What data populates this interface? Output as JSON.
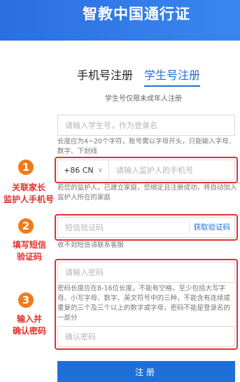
{
  "header": {
    "title": "智教中国通行证"
  },
  "tabs": [
    {
      "label": "手机号注册",
      "active": false
    },
    {
      "label": "学生号注册",
      "active": true
    }
  ],
  "subtitle": "学生号仅限未成年人注册",
  "student_id": {
    "placeholder": "请输入学生号，作为登录名",
    "hint": "长度应为4~20个字符，账号需以字母开头，只能输入字母、数字、下划线"
  },
  "guardian_phone": {
    "country_code": "+86 CN",
    "placeholder": "请输入监护人的手机号",
    "hint": "若您的监护人，已建立家庭，您绑定且注册成功，将自动加入监护人所在的家庭"
  },
  "sms_code": {
    "placeholder": "短信验证码",
    "button": "获取验证码",
    "hint": "收不到短信请联系客服"
  },
  "password": {
    "placeholder": "请输入密码",
    "hint": "密码长度应在8-16位长度，不能有空格，至少包括大写字母、小写字母、数字、英文符号中的三种，不能含有连续或重复的三个及三个以上的数字或字母，密码不能是登录名的一部分"
  },
  "confirm_password": {
    "placeholder": "确认密码"
  },
  "submit": {
    "label": "注册"
  },
  "annotations": [
    {
      "number": "1",
      "text": "关联家长\n监护人手机号"
    },
    {
      "number": "2",
      "text": "填写短信\n验证码"
    },
    {
      "number": "3",
      "text": "输入并\n确认密码"
    }
  ],
  "colors": {
    "brand": "#1f6fd8",
    "annotation": "#e53030",
    "badge": "#f07a1a"
  }
}
